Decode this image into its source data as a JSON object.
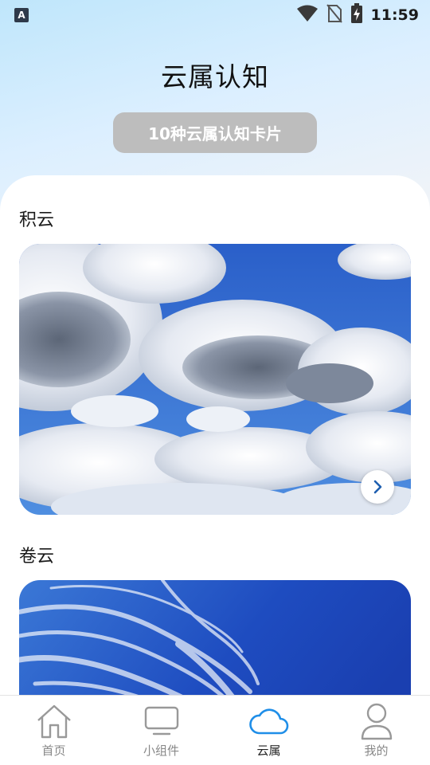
{
  "status_bar": {
    "left_icon_letter": "A",
    "time": "11:59",
    "icons": [
      "wifi-icon",
      "no-sim-icon",
      "battery-charging-icon"
    ]
  },
  "header": {
    "title": "云属认知",
    "pill_label": "10种云属认知卡片"
  },
  "sections": [
    {
      "title": "积云",
      "image": "cumulus-cloud-photo",
      "has_arrow": true
    },
    {
      "title": "卷云",
      "image": "cirrus-cloud-photo",
      "has_arrow": false
    }
  ],
  "bottom_nav": {
    "items": [
      {
        "label": "首页",
        "icon": "home-icon",
        "active": false
      },
      {
        "label": "小组件",
        "icon": "monitor-icon",
        "active": false
      },
      {
        "label": "云属",
        "icon": "cloud-icon",
        "active": true
      },
      {
        "label": "我的",
        "icon": "person-icon",
        "active": false
      }
    ]
  },
  "colors": {
    "accent": "#1f8ee8",
    "pill_bg": "#bdbdbd",
    "nav_inactive": "#888888"
  }
}
